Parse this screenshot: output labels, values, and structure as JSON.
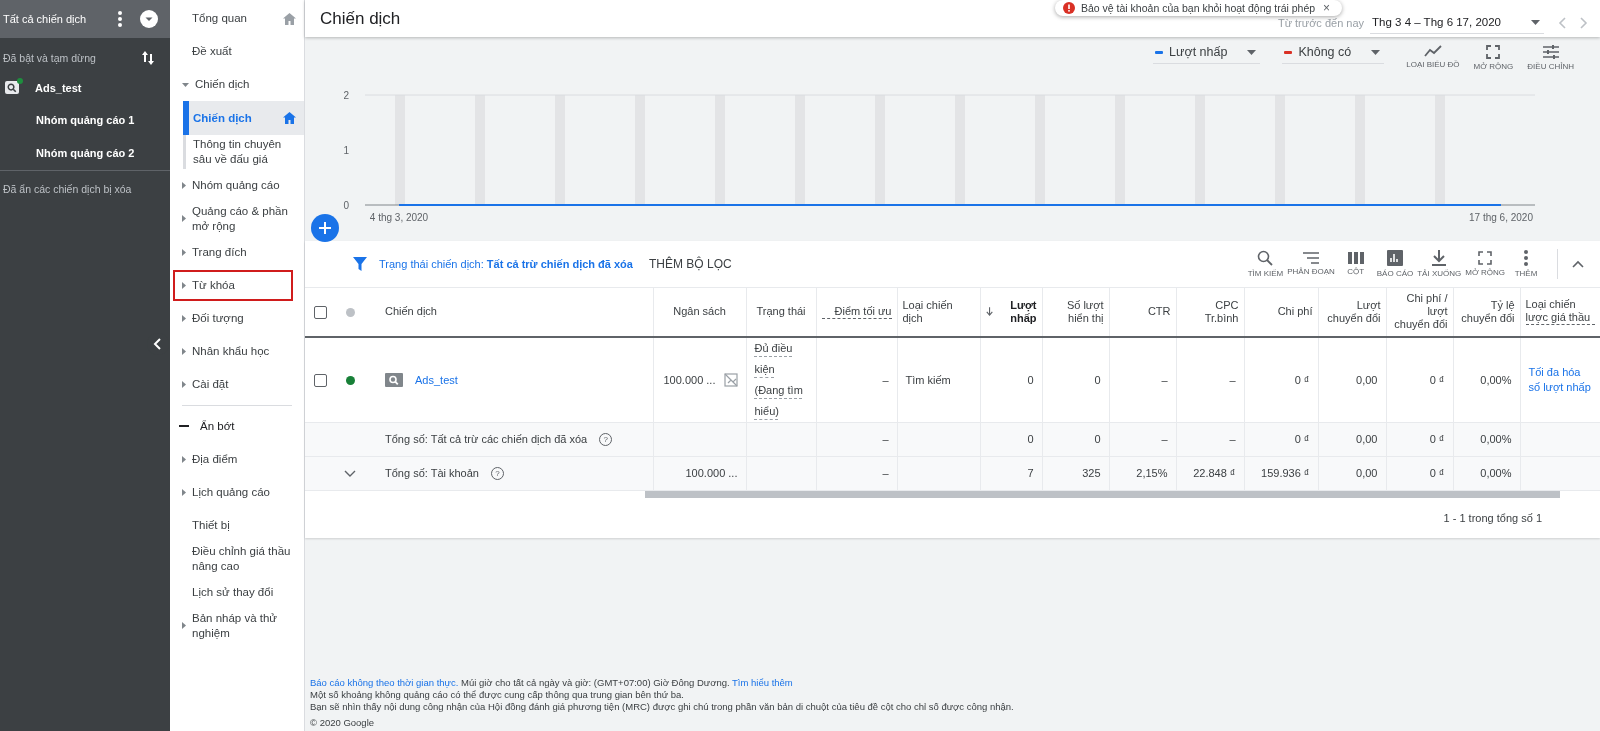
{
  "account_panel": {
    "title": "Tất cả chiến dịch",
    "filter_label": "Đã bật và tạm dừng",
    "campaigns": [
      {
        "name": "Ads_test",
        "color": "#1e8e3e",
        "children": [
          {
            "name": "Nhóm quảng cáo 1"
          },
          {
            "name": "Nhóm quảng cáo 2"
          }
        ]
      }
    ],
    "footer_label": "Đã ẩn các chiến dịch bị xóa"
  },
  "nav": [
    {
      "label": "Tổng quan",
      "kind": "item",
      "selected": false,
      "home": true
    },
    {
      "label": "Đề xuất",
      "kind": "item",
      "selected": false,
      "home": false
    },
    {
      "label": "Chiến dịch",
      "kind": "group",
      "selected": false,
      "expanded": true,
      "highlighted": false,
      "children": [
        {
          "label": "Chiến dịch",
          "kind": "item",
          "selected": true,
          "home": true
        },
        {
          "label": "Thông tin chuyên sâu về đấu giá",
          "kind": "item",
          "selected": false,
          "home": false
        }
      ]
    },
    {
      "label": "Nhóm quảng cáo",
      "kind": "group",
      "selected": false,
      "expanded": false,
      "highlighted": false
    },
    {
      "label": "Quảng cáo & phần mở rộng",
      "kind": "group",
      "selected": false,
      "expanded": false,
      "highlighted": false
    },
    {
      "label": "Trang đích",
      "kind": "group",
      "selected": false,
      "expanded": false,
      "highlighted": false
    },
    {
      "label": "Từ khóa",
      "kind": "group",
      "selected": false,
      "expanded": false,
      "highlighted": true
    },
    {
      "label": "Đối tượng",
      "kind": "group",
      "selected": false,
      "expanded": false,
      "highlighted": false
    },
    {
      "label": "Nhân khẩu học",
      "kind": "group",
      "selected": false,
      "expanded": false,
      "highlighted": false
    },
    {
      "label": "Cài đặt",
      "kind": "group",
      "selected": false,
      "expanded": false,
      "highlighted": false
    },
    {
      "label": "Ẩn bớt",
      "kind": "toggle"
    },
    {
      "label": "Địa điểm",
      "kind": "group",
      "selected": false,
      "expanded": false,
      "highlighted": false
    },
    {
      "label": "Lịch quảng cáo",
      "kind": "group",
      "selected": false,
      "expanded": false,
      "highlighted": false
    },
    {
      "label": "Thiết bị",
      "kind": "item",
      "selected": false,
      "home": false
    },
    {
      "label": "Điều chỉnh giá thầu nâng cao",
      "kind": "item",
      "selected": false,
      "home": false
    },
    {
      "label": "Lịch sử thay đổi",
      "kind": "item",
      "selected": false,
      "home": false
    },
    {
      "label": "Bản nháp và thử nghiệm",
      "kind": "group",
      "selected": false,
      "expanded": false,
      "highlighted": false
    }
  ],
  "header": {
    "title": "Chiến dịch",
    "toast": "Bảo vệ tài khoản của bạn khỏi hoạt động trái phép",
    "toast_close": "×",
    "range_label": "Từ trước đến nay",
    "range": "Thg 3 4 – Thg 6 17, 2020"
  },
  "chart_controls": {
    "compare_metric": {
      "label": "Không có",
      "color": "#d93025"
    },
    "tools": [
      "LOẠI BIỂU ĐỒ",
      "MỞ RỘNG",
      "ĐIỀU CHỈNH"
    ]
  },
  "chart": {
    "chart_data": {
      "type": "line",
      "categories": [
        "4 thg 3, 2020",
        "17 thg 6, 2020"
      ],
      "series": [
        {
          "name": "Lượt nhấp",
          "color": "#1a73e8",
          "values": [
            0,
            0
          ]
        }
      ],
      "ylim": [
        0,
        2
      ],
      "yticks": [
        0,
        1,
        2
      ]
    }
  },
  "filter_bar": {
    "filter_label": "Trạng thái chiến dịch:",
    "filter_value": "Tất cả trừ chiến dịch đã xóa",
    "add_filter": "THÊM BỘ LỌC",
    "tools": [
      "TÌM KIẾM",
      "PHÂN ĐOẠN",
      "CỘT",
      "BÁO CÁO",
      "TẢI XUỐNG",
      "MỞ RỘNG",
      "THÊM"
    ]
  },
  "table": {
    "header_checked": false,
    "columns": [
      {
        "label": "Chiến dịch",
        "kind": "name",
        "sorted": false,
        "tooltip": false
      },
      {
        "label": "Ngân sách",
        "kind": "budget",
        "sorted": false,
        "tooltip": false
      },
      {
        "label": "Trạng thái",
        "kind": "status",
        "sorted": false,
        "tooltip": false
      },
      {
        "label": "Điểm tối ưu",
        "kind": "number",
        "sorted": false,
        "tooltip": true
      },
      {
        "label": "Loại chiến dịch",
        "kind": "text",
        "sorted": false,
        "tooltip": false
      },
      {
        "label": "Lượt nhấp",
        "kind": "number",
        "sorted": true,
        "tooltip": false
      },
      {
        "label": "Số lượt hiển thị",
        "kind": "number",
        "sorted": false,
        "tooltip": false
      },
      {
        "label": "CTR",
        "kind": "number",
        "sorted": false,
        "tooltip": false
      },
      {
        "label": "CPC Tr.bình",
        "kind": "number",
        "sorted": false,
        "tooltip": false
      },
      {
        "label": "Chi phí",
        "kind": "number",
        "sorted": false,
        "tooltip": false
      },
      {
        "label": "Lượt chuyển đổi",
        "kind": "number",
        "sorted": false,
        "tooltip": false
      },
      {
        "label": "Chi phí / lượt chuyển đổi",
        "kind": "number",
        "sorted": false,
        "tooltip": false
      },
      {
        "label": "Tỷ lệ chuyển đổi",
        "kind": "number",
        "sorted": false,
        "tooltip": false
      },
      {
        "label": "Loại chiến lược giá thầu",
        "kind": "link",
        "sorted": false,
        "tooltip": true
      }
    ],
    "rows": [
      {
        "kind": "campaign",
        "checked": false,
        "color": "#188038",
        "budget_limited": true,
        "cells": [
          "Ads_test",
          "100.000 ...",
          "Đủ điều kiện (Đang tìm hiểu)",
          "–",
          "Tìm kiếm",
          "0",
          "0",
          "–",
          "–",
          "0 ₫",
          "0,00",
          "0 ₫",
          "0,00%",
          "Tối đa hóa số lượt nhấp"
        ]
      },
      {
        "kind": "total",
        "help": "?",
        "cells": [
          "Tổng số: Tất cả trừ các chiến dịch đã xóa",
          "",
          "",
          "–",
          "",
          "0",
          "0",
          "–",
          "–",
          "0 ₫",
          "0,00",
          "0 ₫",
          "0,00%",
          ""
        ]
      },
      {
        "kind": "account_total",
        "expanded": false,
        "help": "?",
        "cells": [
          "Tổng số: Tài khoản",
          "100.000 ...",
          "",
          "–",
          "",
          "7",
          "325",
          "2,15%",
          "22.848 ₫",
          "159.936 ₫",
          "0,00",
          "0 ₫",
          "0,00%",
          ""
        ]
      }
    ],
    "pagination": "1 - 1 trong tổng số 1"
  },
  "footer": {
    "line_1": {
      "link": "Báo cáo không theo thời gian thực.",
      "text": " Múi giờ cho tất cả ngày và giờ: (GMT+07:00) Giờ Đông Dương. ",
      "link_2": "Tìm hiểu thêm"
    },
    "line_2": "Một số khoảng không quảng cáo có thể được cung cấp thông qua trung gian bên thứ ba.",
    "line_3": "Bạn sẽ nhìn thấy nội dung công nhận của Hội đồng đánh giá phương tiện (MRC) được ghi chú trong phần văn bản di chuột của tiêu đề cột cho chỉ số được công nhận.",
    "copyright": "© 2020 Google"
  }
}
